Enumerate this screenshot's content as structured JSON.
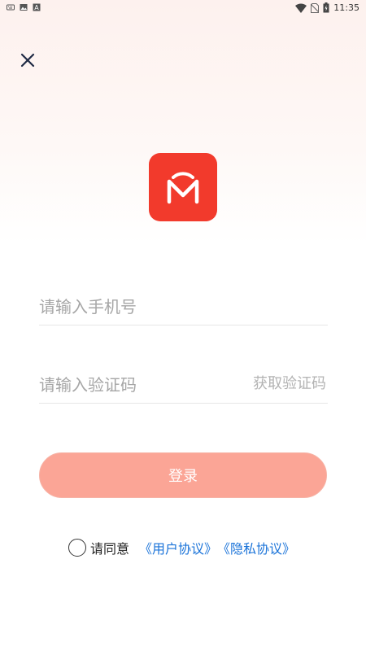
{
  "status_bar": {
    "time": "11:35",
    "left_icons": [
      "keyboard-icon",
      "image-icon",
      "font-icon"
    ],
    "right_icons": [
      "wifi-icon",
      "no-sim-icon",
      "battery-icon"
    ]
  },
  "close": {
    "icon": "close-icon"
  },
  "logo": {
    "brand_color": "#f23a2c"
  },
  "form": {
    "phone_placeholder": "请输入手机号",
    "code_placeholder": "请输入验证码",
    "get_code_label": "获取验证码",
    "login_label": "登录"
  },
  "agreement": {
    "prefix": "请同意",
    "user_agreement": "《用户协议》",
    "privacy_policy": "《隐私协议》",
    "link_color": "#1a73d9"
  },
  "colors": {
    "login_button": "#fba596",
    "placeholder": "#a6a6a6"
  }
}
